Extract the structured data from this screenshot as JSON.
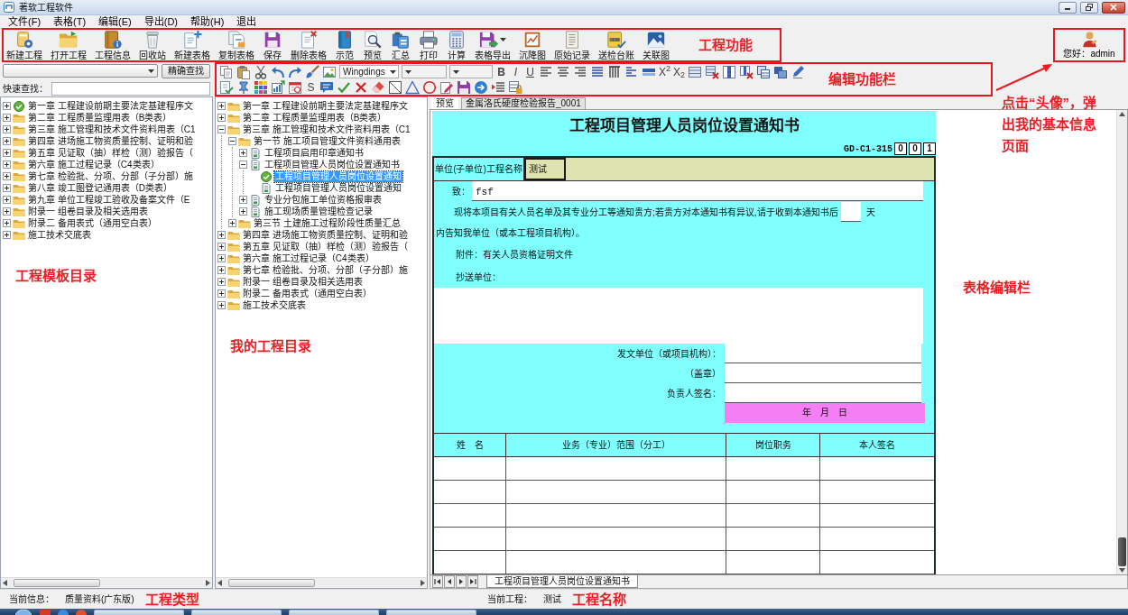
{
  "window": {
    "title": "著软工程软件"
  },
  "menu": [
    "文件(F)",
    "表格(T)",
    "编辑(E)",
    "导出(D)",
    "帮助(H)",
    "退出"
  ],
  "main_toolbar": {
    "highlighted": true,
    "annotation": "工程功能",
    "buttons": [
      {
        "label": "新建工程",
        "dropdown": false
      },
      {
        "label": "打开工程",
        "dropdown": false
      },
      {
        "label": "工程信息",
        "dropdown": false
      },
      {
        "label": "回收站",
        "dropdown": false
      },
      {
        "label": "新建表格",
        "dropdown": false
      },
      {
        "label": "复制表格",
        "dropdown": false
      },
      {
        "label": "保存",
        "dropdown": false
      },
      {
        "label": "删除表格",
        "dropdown": false
      },
      {
        "label": "示范",
        "dropdown": false
      },
      {
        "label": "预览",
        "dropdown": false
      },
      {
        "label": "汇总",
        "dropdown": false
      },
      {
        "label": "打印",
        "dropdown": false
      },
      {
        "label": "计算",
        "dropdown": false
      },
      {
        "label": "表格导出",
        "dropdown": true
      },
      {
        "label": "沉降图",
        "dropdown": false
      },
      {
        "label": "原始记录",
        "dropdown": false
      },
      {
        "label": "送检台账",
        "dropdown": false
      },
      {
        "label": "关联图",
        "dropdown": false
      }
    ]
  },
  "user": {
    "greeting": "您好：admin",
    "highlighted": true,
    "callout": "点击“头像”，弹出我的基本信息页面"
  },
  "search": {
    "button": "精确查找",
    "quick_label": "快速查找："
  },
  "edit_toolbar": {
    "highlighted": true,
    "annotation": "编辑功能栏",
    "rows": [
      [
        {
          "kind": "icon"
        },
        {
          "kind": "icon"
        },
        {
          "kind": "icon"
        },
        {
          "kind": "icon"
        },
        {
          "kind": "icon"
        },
        {
          "kind": "icon"
        },
        {
          "kind": "icon"
        },
        {
          "kind": "dropdown",
          "value": "Wingdings"
        },
        {
          "kind": "dropdown"
        },
        {
          "kind": "dropdown"
        },
        {
          "kind": "glyph",
          "text": "B"
        },
        {
          "kind": "glyph",
          "text": "I"
        },
        {
          "kind": "glyph",
          "text": "U"
        },
        {
          "kind": "icon"
        },
        {
          "kind": "icon"
        },
        {
          "kind": "icon"
        },
        {
          "kind": "icon"
        },
        {
          "kind": "icon"
        },
        {
          "kind": "icon"
        },
        {
          "kind": "icon"
        },
        {
          "kind": "glyph",
          "text": "X$^{2}$"
        },
        {
          "kind": "glyph",
          "text": "X$_{2}$"
        },
        {
          "kind": "icon"
        },
        {
          "kind": "icon"
        },
        {
          "kind": "icon"
        },
        {
          "kind": "icon"
        },
        {
          "kind": "icon"
        },
        {
          "kind": "icon"
        },
        {
          "kind": "icon"
        }
      ],
      [
        {
          "kind": "icon"
        },
        {
          "kind": "icon"
        },
        {
          "kind": "icon"
        },
        {
          "kind": "icon"
        },
        {
          "kind": "icon"
        },
        {
          "kind": "glyph",
          "text": "S"
        },
        {
          "kind": "icon"
        },
        {
          "kind": "icon"
        },
        {
          "kind": "icon"
        },
        {
          "kind": "icon"
        },
        {
          "kind": "icon"
        },
        {
          "kind": "icon"
        },
        {
          "kind": "icon"
        },
        {
          "kind": "icon"
        },
        {
          "kind": "icon"
        },
        {
          "kind": "icon"
        },
        {
          "kind": "icon"
        },
        {
          "kind": "icon"
        }
      ]
    ]
  },
  "template_tree": {
    "annotation": "工程模板目录",
    "items": [
      {
        "label": "第一章 工程建设前期主要法定基建程序文",
        "kind": "checked",
        "expanded": false,
        "selected": false
      },
      {
        "label": "第二章 工程质量监理用表（B类表）",
        "kind": "folder",
        "expanded": false,
        "selected": false
      },
      {
        "label": "第三章 施工管理和技术文件资料用表（C1",
        "kind": "folder",
        "expanded": false,
        "selected": false
      },
      {
        "label": "第四章 进场施工物资质量控制、证明和验",
        "kind": "folder",
        "expanded": false,
        "selected": false
      },
      {
        "label": "第五章 见证取（抽）样检（测）验报告（",
        "kind": "folder",
        "expanded": false,
        "selected": false
      },
      {
        "label": "第六章 施工过程记录（C4类表）",
        "kind": "folder",
        "expanded": false,
        "selected": false
      },
      {
        "label": "第七章 检验批、分项、分部（子分部）施",
        "kind": "folder",
        "expanded": false,
        "selected": false
      },
      {
        "label": "第八章 竣工图登记通用表（D类表）",
        "kind": "folder",
        "expanded": false,
        "selected": false
      },
      {
        "label": "第九章 单位工程竣工验收及备案文件（E",
        "kind": "folder",
        "expanded": false,
        "selected": false
      },
      {
        "label": "附录一 组卷目录及相关选用表",
        "kind": "folder",
        "expanded": false,
        "selected": false
      },
      {
        "label": "附录二 备用表式（通用空白表）",
        "kind": "folder",
        "expanded": false,
        "selected": false
      },
      {
        "label": "施工技术交底表",
        "kind": "folder",
        "expanded": false,
        "selected": false
      }
    ]
  },
  "project_tree": {
    "annotation": "我的工程目录",
    "items": [
      {
        "label": "第一章 工程建设前期主要法定基建程序文",
        "kind": "folder",
        "expanded": false,
        "selected": false
      },
      {
        "label": "第二章 工程质量监理用表（B类表）",
        "kind": "folder",
        "expanded": false,
        "selected": false
      },
      {
        "label": "第三章 施工管理和技术文件资料用表（C1",
        "kind": "folder",
        "expanded": true,
        "selected": false,
        "children": [
          {
            "label": "第一节 施工项目管理文件资料通用表",
            "kind": "folder",
            "expanded": true,
            "selected": false,
            "children": [
              {
                "label": "工程项目启用印章通知书",
                "kind": "form",
                "expanded": false,
                "selected": false
              },
              {
                "label": "工程项目管理人员岗位设置通知书",
                "kind": "form",
                "expanded": true,
                "selected": false,
                "children": [
                  {
                    "label": "工程项目管理人员岗位设置通知",
                    "kind": "checked",
                    "selected": true
                  },
                  {
                    "label": "工程项目管理人员岗位设置通知",
                    "kind": "form",
                    "selected": false
                  }
                ]
              },
              {
                "label": "专业分包施工单位资格报审表",
                "kind": "form",
                "expanded": false,
                "selected": false
              },
              {
                "label": "施工现场质量管理检查记录",
                "kind": "form",
                "expanded": false,
                "selected": false
              }
            ]
          },
          {
            "label": "第三节 土建施工过程阶段性质量汇总",
            "kind": "folder",
            "expanded": false,
            "selected": false
          }
        ]
      },
      {
        "label": "第四章 进场施工物资质量控制、证明和验",
        "kind": "folder",
        "expanded": false,
        "selected": false
      },
      {
        "label": "第五章 见证取（抽）样检（测）验报告（",
        "kind": "folder",
        "expanded": false,
        "selected": false
      },
      {
        "label": "第六章 施工过程记录（C4类表）",
        "kind": "folder",
        "expanded": false,
        "selected": false
      },
      {
        "label": "第七章 检验批、分项、分部（子分部）施",
        "kind": "folder",
        "expanded": false,
        "selected": false
      },
      {
        "label": "附录一 组卷目录及相关选用表",
        "kind": "folder",
        "expanded": false,
        "selected": false
      },
      {
        "label": "附录二 备用表式（通用空白表）",
        "kind": "folder",
        "expanded": false,
        "selected": false
      },
      {
        "label": "施工技术交底表",
        "kind": "folder",
        "expanded": false,
        "selected": false
      }
    ]
  },
  "document": {
    "tabs": [
      {
        "label": "预览",
        "selected": true
      },
      {
        "label": "金属洛氏硬度检验报告_0001",
        "selected": false
      }
    ],
    "annotation": "表格编辑栏",
    "form": {
      "title": "工程项目管理人员岗位设置通知书",
      "code": "GD-C1-315",
      "serial": [
        "0",
        "0",
        "1"
      ],
      "project_name": {
        "label": "单位(子单位)工程名称",
        "value": "测试",
        "selected": true
      },
      "addressee": {
        "label": "致：",
        "value": "fsf"
      },
      "notice_start": "现将本项目有关人员名单及其专业分工等通知贵方;若贵方对本通知书有异议,请于收到本通知书后",
      "days_unit": "天",
      "notice_end": "内告知我单位（或本工程项目机构）。",
      "attachment": "附件：有关人员资格证明文件",
      "cc_label": "抄送单位：",
      "signoff": [
        "发文单位（或项目机构）：",
        "（盖章）",
        "负责人签名："
      ],
      "date": "年　月　日",
      "staff_columns": [
        "姓　名",
        "业务（专业）范围（分工）",
        "岗位职务",
        "本人签名"
      ]
    },
    "sheet_tabs": [
      {
        "label": "工程项目管理人员岗位设置通知书",
        "selected": true
      }
    ]
  },
  "status_bar": {
    "info_label": "当前信息：",
    "info_value": "质量资料(广东版)",
    "info_annotation": "工程类型",
    "project_label": "当前工程：",
    "project_value": "测试",
    "project_annotation": "工程名称"
  }
}
